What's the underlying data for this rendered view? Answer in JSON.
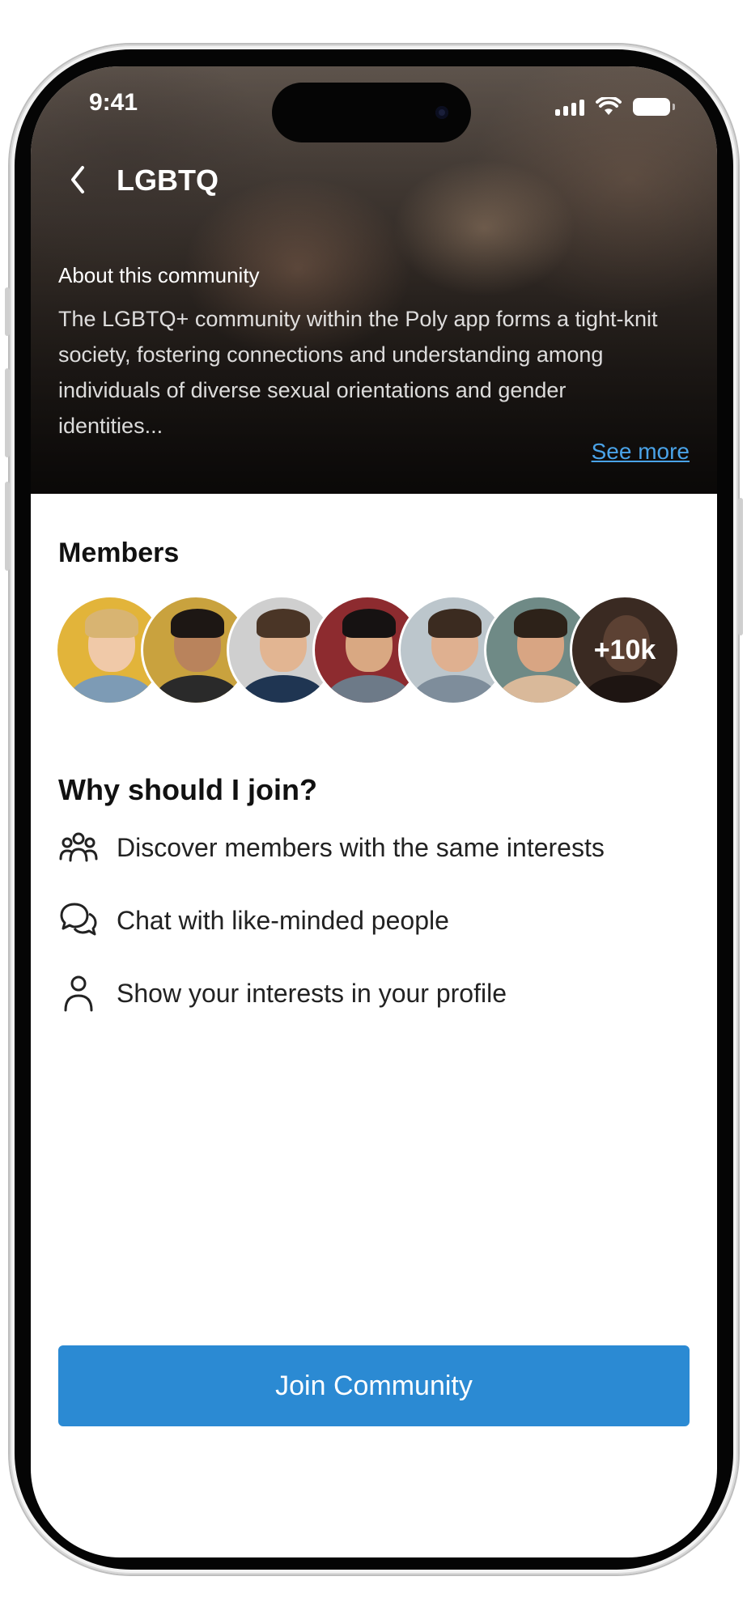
{
  "status_bar": {
    "time": "9:41"
  },
  "header": {
    "title": "LGBTQ"
  },
  "about": {
    "heading": "About this community",
    "text": "The LGBTQ+ community within the Poly app forms a tight-knit society, fostering connections and understanding among individuals of diverse sexual orientations and gender identities...",
    "see_more": "See more"
  },
  "members": {
    "title": "Members",
    "more_count": "+10k",
    "avatars": [
      {
        "name": "avatar-1",
        "bg": "#e2b43a",
        "skin": "#f0c9a8",
        "hair": "#d8b472",
        "shirt": "#7d9bb5"
      },
      {
        "name": "avatar-2",
        "bg": "#c9a23e",
        "skin": "#b9835c",
        "hair": "#1d1714",
        "shirt": "#2a2a2a"
      },
      {
        "name": "avatar-3",
        "bg": "#cfcfcf",
        "skin": "#e2b592",
        "hair": "#4a3526",
        "shirt": "#1f3552"
      },
      {
        "name": "avatar-4",
        "bg": "#8d2b2f",
        "skin": "#d9a882",
        "hair": "#161212",
        "shirt": "#6d7a88"
      },
      {
        "name": "avatar-5",
        "bg": "#bcc6cc",
        "skin": "#dfb090",
        "hair": "#3b2b20",
        "shirt": "#7e8d9b"
      },
      {
        "name": "avatar-6",
        "bg": "#6f8a86",
        "skin": "#d8a583",
        "hair": "#2d2219",
        "shirt": "#d9b99a"
      }
    ],
    "more_bg": "#3a2a22"
  },
  "why": {
    "title": "Why should I join?",
    "reasons": [
      {
        "icon": "people-group-icon",
        "text": "Discover members with the same interests"
      },
      {
        "icon": "chat-bubbles-icon",
        "text": "Chat with like-minded people"
      },
      {
        "icon": "person-icon",
        "text": "Show your interests in your profile"
      }
    ]
  },
  "cta": {
    "join_label": "Join Community"
  },
  "colors": {
    "accent": "#2b8ad3",
    "link": "#4aa3e8"
  }
}
